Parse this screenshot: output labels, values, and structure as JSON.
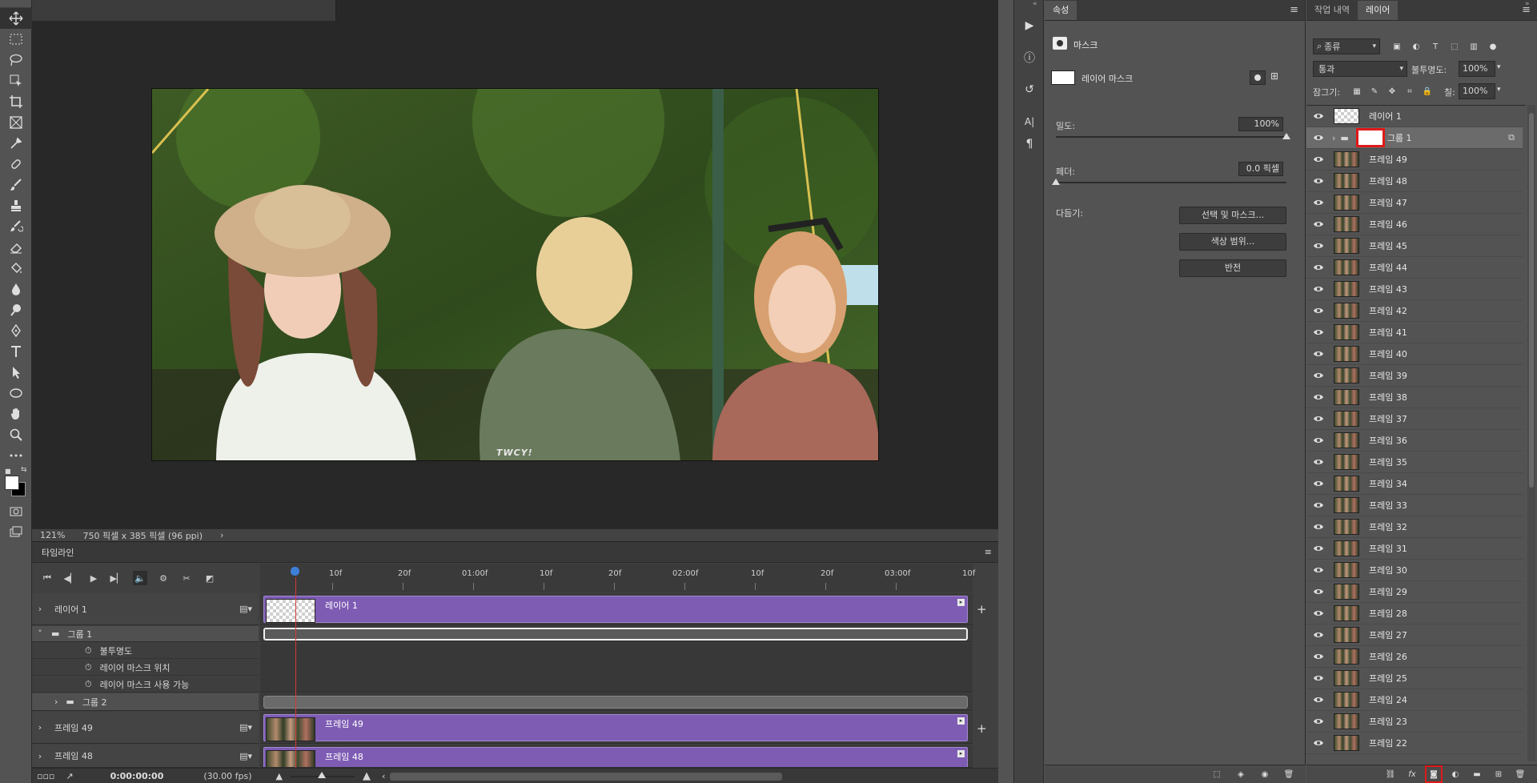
{
  "status": {
    "zoom": "121%",
    "doc_info": "750 픽셀 x 385 픽셀 (96 ppi)"
  },
  "timeline": {
    "tab": "타임라인",
    "ruler_labels": [
      "10f",
      "20f",
      "01:00f",
      "10f",
      "20f",
      "02:00f",
      "10f",
      "20f",
      "03:00f",
      "10f"
    ],
    "tracks": [
      {
        "name": "레이어 1",
        "clip": "레이어 1",
        "kind": "layer"
      },
      {
        "name": "그룹 1",
        "kind": "group"
      },
      {
        "name": "불투명도",
        "kind": "prop"
      },
      {
        "name": "레이어 마스크 위치",
        "kind": "prop"
      },
      {
        "name": "레이어 마스크 사용 가능",
        "kind": "prop"
      },
      {
        "name": "그룹 2",
        "kind": "subgroup"
      },
      {
        "name": "프레임 49",
        "clip": "프레임 49",
        "kind": "frame"
      },
      {
        "name": "프레임 48",
        "clip": "프레임 48",
        "kind": "frame"
      }
    ],
    "timecode": "0:00:00:00",
    "fps": "(30.00 fps)"
  },
  "properties": {
    "tab": "속성",
    "header": "마스크",
    "mask_label": "레이어 마스크",
    "density_label": "밀도:",
    "density_value": "100%",
    "density_fraction": 1.0,
    "feather_label": "페더:",
    "feather_value": "0.0 픽셀",
    "feather_fraction": 0.0,
    "refine_label": "다듬기:",
    "buttons": [
      "선택 및 마스크...",
      "색상 범위...",
      "반전"
    ]
  },
  "layers_panel": {
    "tabs": [
      "작업 내역",
      "레이어"
    ],
    "filter": "종류",
    "blend_mode": "통과",
    "opacity_label": "불투명도:",
    "opacity_value": "100%",
    "lock_label": "잠그기:",
    "fill_label": "칠:",
    "fill_value": "100%",
    "layers": [
      "레이어 1",
      "그룹 1",
      "프레임 49",
      "프레임 48",
      "프레임 47",
      "프레임 46",
      "프레임 45",
      "프레임 44",
      "프레임 43",
      "프레임 42",
      "프레임 41",
      "프레임 40",
      "프레임 39",
      "프레임 38",
      "프레임 37",
      "프레임 36",
      "프레임 35",
      "프레임 34",
      "프레임 33",
      "프레임 32",
      "프레임 31",
      "프레임 30",
      "프레임 29",
      "프레임 28",
      "프레임 27",
      "프레임 26",
      "프레임 25",
      "프레임 24",
      "프레임 23",
      "프레임 22"
    ]
  },
  "canvas": {
    "watermark": "TWCY!"
  },
  "colors": {
    "accent_highlight": "#e01919",
    "clip_purple": "#7e5cb4",
    "playhead": "#d23a3a"
  }
}
